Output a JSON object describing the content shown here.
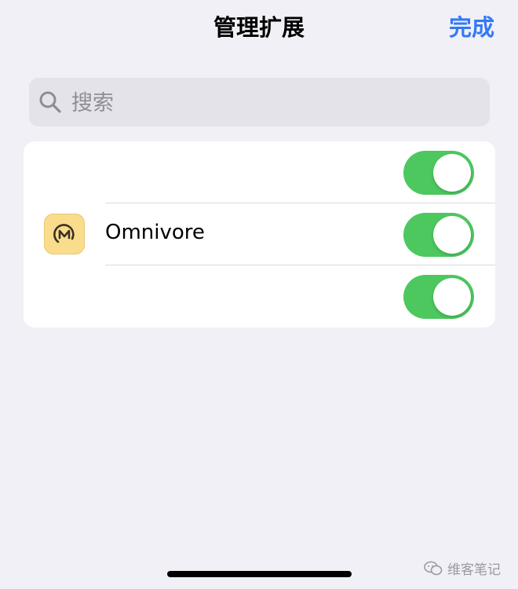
{
  "nav": {
    "title": "管理扩展",
    "done_label": "完成"
  },
  "search": {
    "placeholder": "搜索",
    "value": ""
  },
  "extensions": [
    {
      "label": "",
      "enabled": true,
      "icon": "blank-icon"
    },
    {
      "label": "Omnivore",
      "enabled": true,
      "icon": "omnivore-icon"
    },
    {
      "label": "",
      "enabled": true,
      "icon": "blank-icon"
    }
  ],
  "watermark": {
    "text": "维客笔记",
    "icon": "wechat-icon"
  },
  "colors": {
    "accent": "#3478f6",
    "toggle_on": "#4cc85f",
    "background": "#f1f0f6"
  }
}
